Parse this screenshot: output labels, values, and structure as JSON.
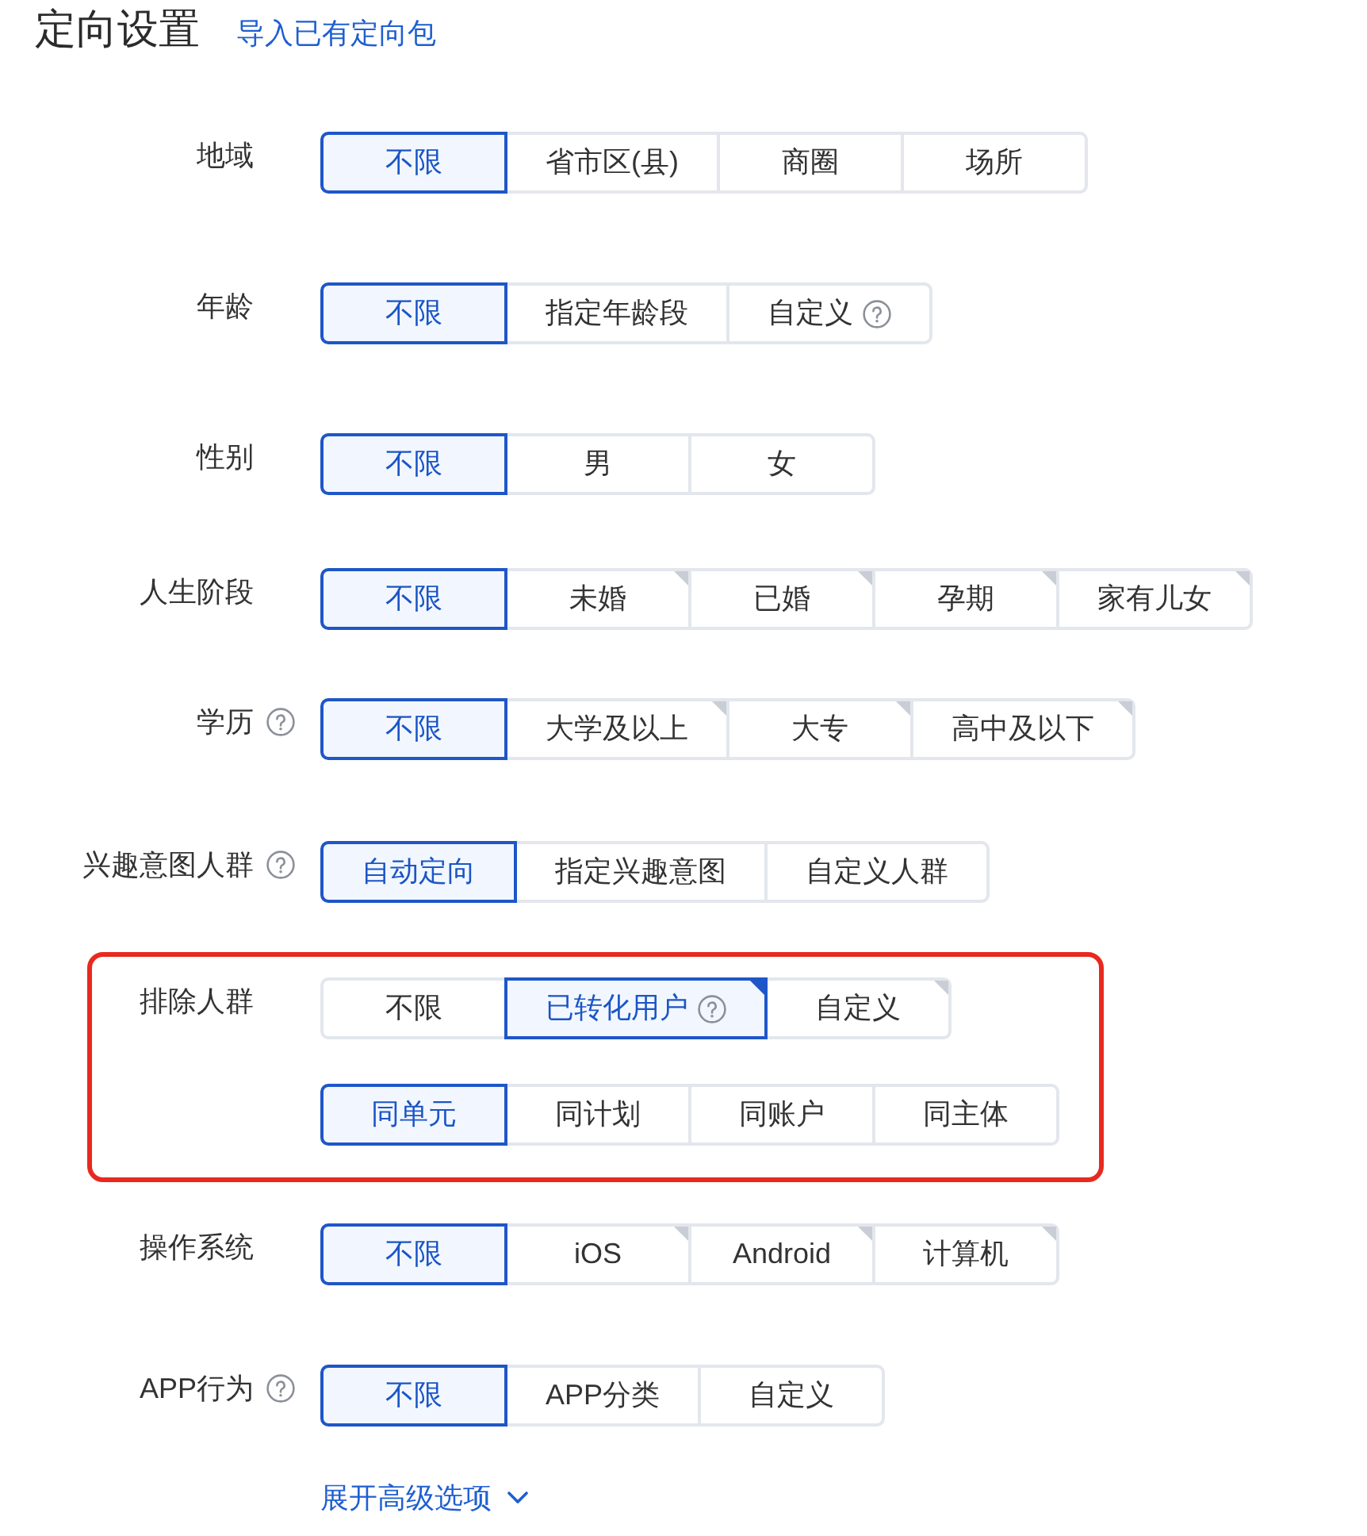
{
  "header": {
    "title": "定向设置",
    "import_link": "导入已有定向包"
  },
  "rows": [
    {
      "label": "地域",
      "help": false,
      "highlighted": false,
      "groups": [
        {
          "options": [
            {
              "label": "不限",
              "selected": true,
              "help": false,
              "corner_mark": false
            },
            {
              "label": "省市区(县)",
              "selected": false,
              "help": false,
              "corner_mark": false
            },
            {
              "label": "商圈",
              "selected": false,
              "help": false,
              "corner_mark": false
            },
            {
              "label": "场所",
              "selected": false,
              "help": false,
              "corner_mark": false
            }
          ]
        }
      ]
    },
    {
      "label": "年龄",
      "help": false,
      "highlighted": false,
      "groups": [
        {
          "options": [
            {
              "label": "不限",
              "selected": true,
              "help": false,
              "corner_mark": false
            },
            {
              "label": "指定年龄段",
              "selected": false,
              "help": false,
              "corner_mark": false
            },
            {
              "label": "自定义",
              "selected": false,
              "help": true,
              "corner_mark": false
            }
          ]
        }
      ]
    },
    {
      "label": "性别",
      "help": false,
      "highlighted": false,
      "groups": [
        {
          "options": [
            {
              "label": "不限",
              "selected": true,
              "help": false,
              "corner_mark": false
            },
            {
              "label": "男",
              "selected": false,
              "help": false,
              "corner_mark": false
            },
            {
              "label": "女",
              "selected": false,
              "help": false,
              "corner_mark": false
            }
          ]
        }
      ]
    },
    {
      "label": "人生阶段",
      "help": false,
      "highlighted": false,
      "groups": [
        {
          "options": [
            {
              "label": "不限",
              "selected": true,
              "help": false,
              "corner_mark": false
            },
            {
              "label": "未婚",
              "selected": false,
              "help": false,
              "corner_mark": true
            },
            {
              "label": "已婚",
              "selected": false,
              "help": false,
              "corner_mark": true
            },
            {
              "label": "孕期",
              "selected": false,
              "help": false,
              "corner_mark": true
            },
            {
              "label": "家有儿女",
              "selected": false,
              "help": false,
              "corner_mark": true
            }
          ]
        }
      ]
    },
    {
      "label": "学历",
      "help": true,
      "highlighted": false,
      "groups": [
        {
          "options": [
            {
              "label": "不限",
              "selected": true,
              "help": false,
              "corner_mark": false
            },
            {
              "label": "大学及以上",
              "selected": false,
              "help": false,
              "corner_mark": true
            },
            {
              "label": "大专",
              "selected": false,
              "help": false,
              "corner_mark": true
            },
            {
              "label": "高中及以下",
              "selected": false,
              "help": false,
              "corner_mark": true
            }
          ]
        }
      ]
    },
    {
      "label": "兴趣意图人群",
      "help": true,
      "highlighted": false,
      "groups": [
        {
          "options": [
            {
              "label": "自动定向",
              "selected": true,
              "help": false,
              "corner_mark": false
            },
            {
              "label": "指定兴趣意图",
              "selected": false,
              "help": false,
              "corner_mark": false
            },
            {
              "label": "自定义人群",
              "selected": false,
              "help": false,
              "corner_mark": false
            }
          ]
        }
      ]
    },
    {
      "label": "排除人群",
      "help": false,
      "highlighted": true,
      "groups": [
        {
          "options": [
            {
              "label": "不限",
              "selected": false,
              "help": false,
              "corner_mark": false
            },
            {
              "label": "已转化用户",
              "selected": true,
              "help": true,
              "corner_mark": true
            },
            {
              "label": "自定义",
              "selected": false,
              "help": false,
              "corner_mark": true
            }
          ]
        },
        {
          "options": [
            {
              "label": "同单元",
              "selected": true,
              "help": false,
              "corner_mark": false
            },
            {
              "label": "同计划",
              "selected": false,
              "help": false,
              "corner_mark": false
            },
            {
              "label": "同账户",
              "selected": false,
              "help": false,
              "corner_mark": false
            },
            {
              "label": "同主体",
              "selected": false,
              "help": false,
              "corner_mark": false
            }
          ]
        }
      ]
    },
    {
      "label": "操作系统",
      "help": false,
      "highlighted": false,
      "groups": [
        {
          "options": [
            {
              "label": "不限",
              "selected": true,
              "help": false,
              "corner_mark": false
            },
            {
              "label": "iOS",
              "selected": false,
              "help": false,
              "corner_mark": true
            },
            {
              "label": "Android",
              "selected": false,
              "help": false,
              "corner_mark": true
            },
            {
              "label": "计算机",
              "selected": false,
              "help": false,
              "corner_mark": true
            }
          ]
        }
      ]
    },
    {
      "label": "APP行为",
      "help": true,
      "highlighted": false,
      "groups": [
        {
          "options": [
            {
              "label": "不限",
              "selected": true,
              "help": false,
              "corner_mark": false
            },
            {
              "label": "APP分类",
              "selected": false,
              "help": false,
              "corner_mark": false
            },
            {
              "label": "自定义",
              "selected": false,
              "help": false,
              "corner_mark": false
            }
          ]
        }
      ]
    }
  ],
  "expand_link": {
    "label": "展开高级选项"
  }
}
